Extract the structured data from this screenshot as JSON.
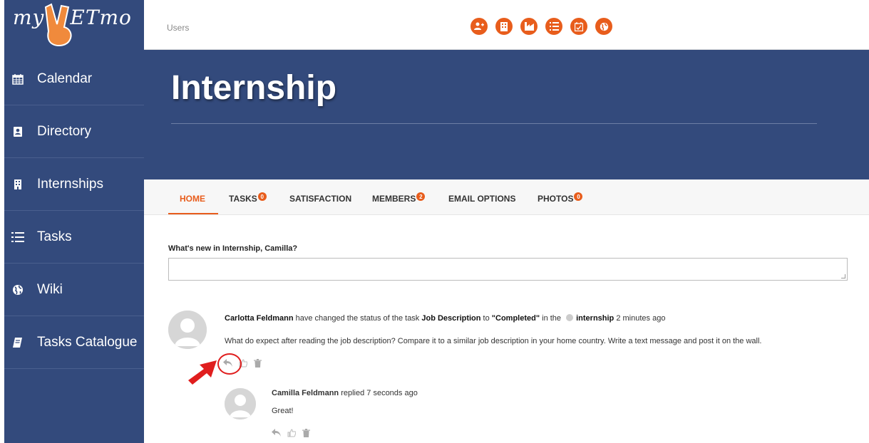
{
  "logo": {
    "text_left": "my",
    "text_right": "ETmo"
  },
  "sidebar": {
    "items": [
      {
        "label": "Calendar",
        "icon": "calendar-icon"
      },
      {
        "label": "Directory",
        "icon": "contact-card-icon"
      },
      {
        "label": "Internships",
        "icon": "building-icon"
      },
      {
        "label": "Tasks",
        "icon": "list-icon"
      },
      {
        "label": "Wiki",
        "icon": "globe-icon"
      },
      {
        "label": "Tasks Catalogue",
        "icon": "book-icon"
      }
    ]
  },
  "topbar": {
    "breadcrumb": "Users",
    "icons": [
      "add-user-icon",
      "building-icon",
      "factory-icon",
      "list-icon",
      "calendar-check-icon",
      "globe-icon"
    ]
  },
  "hero": {
    "title": "Internship"
  },
  "tabs": [
    {
      "label": "HOME",
      "badge": ""
    },
    {
      "label": "TASKS",
      "badge": "0"
    },
    {
      "label": "SATISFACTION",
      "badge": ""
    },
    {
      "label": "MEMBERS",
      "badge": "2"
    },
    {
      "label": "EMAIL OPTIONS",
      "badge": ""
    },
    {
      "label": "PHOTOS",
      "badge": "0"
    }
  ],
  "composer": {
    "prompt": "What's new in Internship, Camilla?",
    "value": ""
  },
  "activity": {
    "author": "Carlotta Feldmann",
    "text1": " have changed the status of the task ",
    "task": "Job Description",
    "text2": " to ",
    "status": "\"Completed\"",
    "text3": " in the ",
    "group": "internship",
    "time": " 2 minutes ago",
    "body": "What do expect after reading the job description? Compare it to a similar job description in your home country. Write a text message and post it on the wall."
  },
  "reply": {
    "author": "Camilla Feldmann",
    "text": " replied 7 seconds ago",
    "body": "Great!"
  },
  "colors": {
    "primary": "#334a7c",
    "accent": "#e85d1c",
    "highlight": "#e01e1e"
  }
}
